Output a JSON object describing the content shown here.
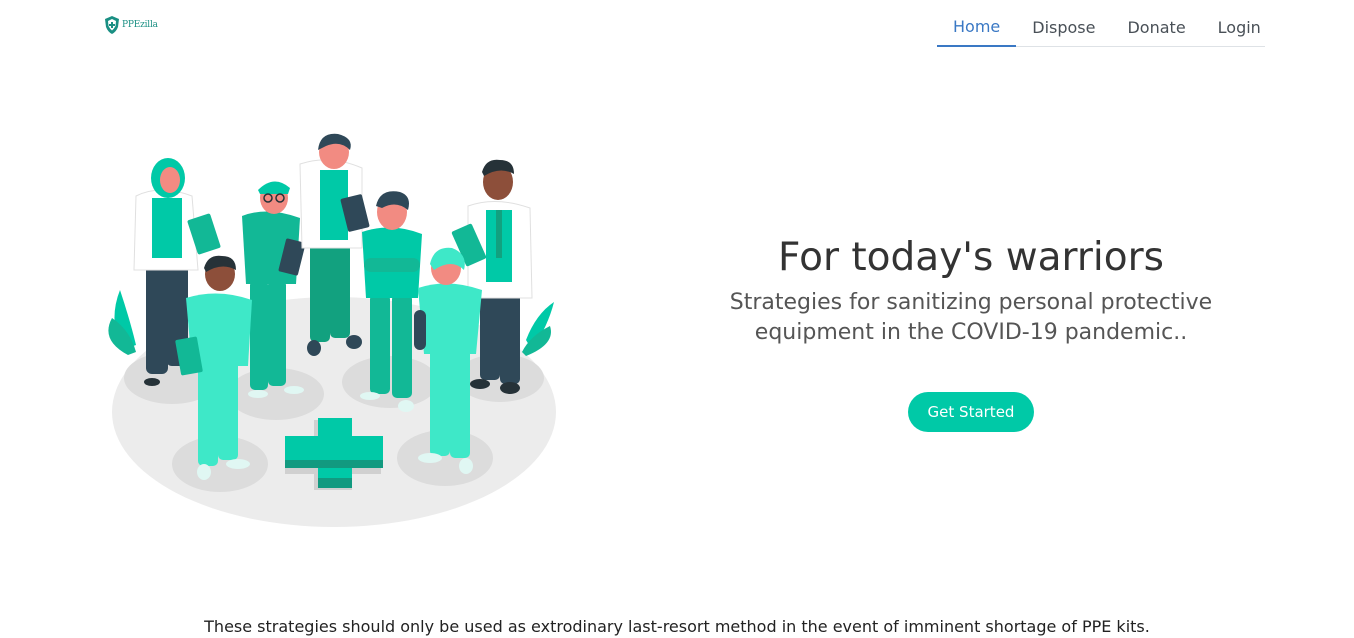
{
  "brand": {
    "logo_text": "PPEzilla",
    "accent_color": "#00c9a7",
    "logo_color": "#1a8f83"
  },
  "nav": {
    "items": [
      {
        "label": "Home",
        "active": true
      },
      {
        "label": "Dispose",
        "active": false
      },
      {
        "label": "Donate",
        "active": false
      },
      {
        "label": "Login",
        "active": false
      }
    ],
    "active_color": "#3a78c4"
  },
  "hero": {
    "title": "For today's warriors",
    "subtitle": "Strategies for sanitizing personal protective equipment in the COVID-19 pandemic..",
    "cta_label": "Get Started"
  },
  "illustration": {
    "icon": "medical-team-illustration"
  },
  "footer": {
    "note": "These strategies should only be used as extrodinary last-resort method in the event of imminent shortage of PPE kits."
  }
}
